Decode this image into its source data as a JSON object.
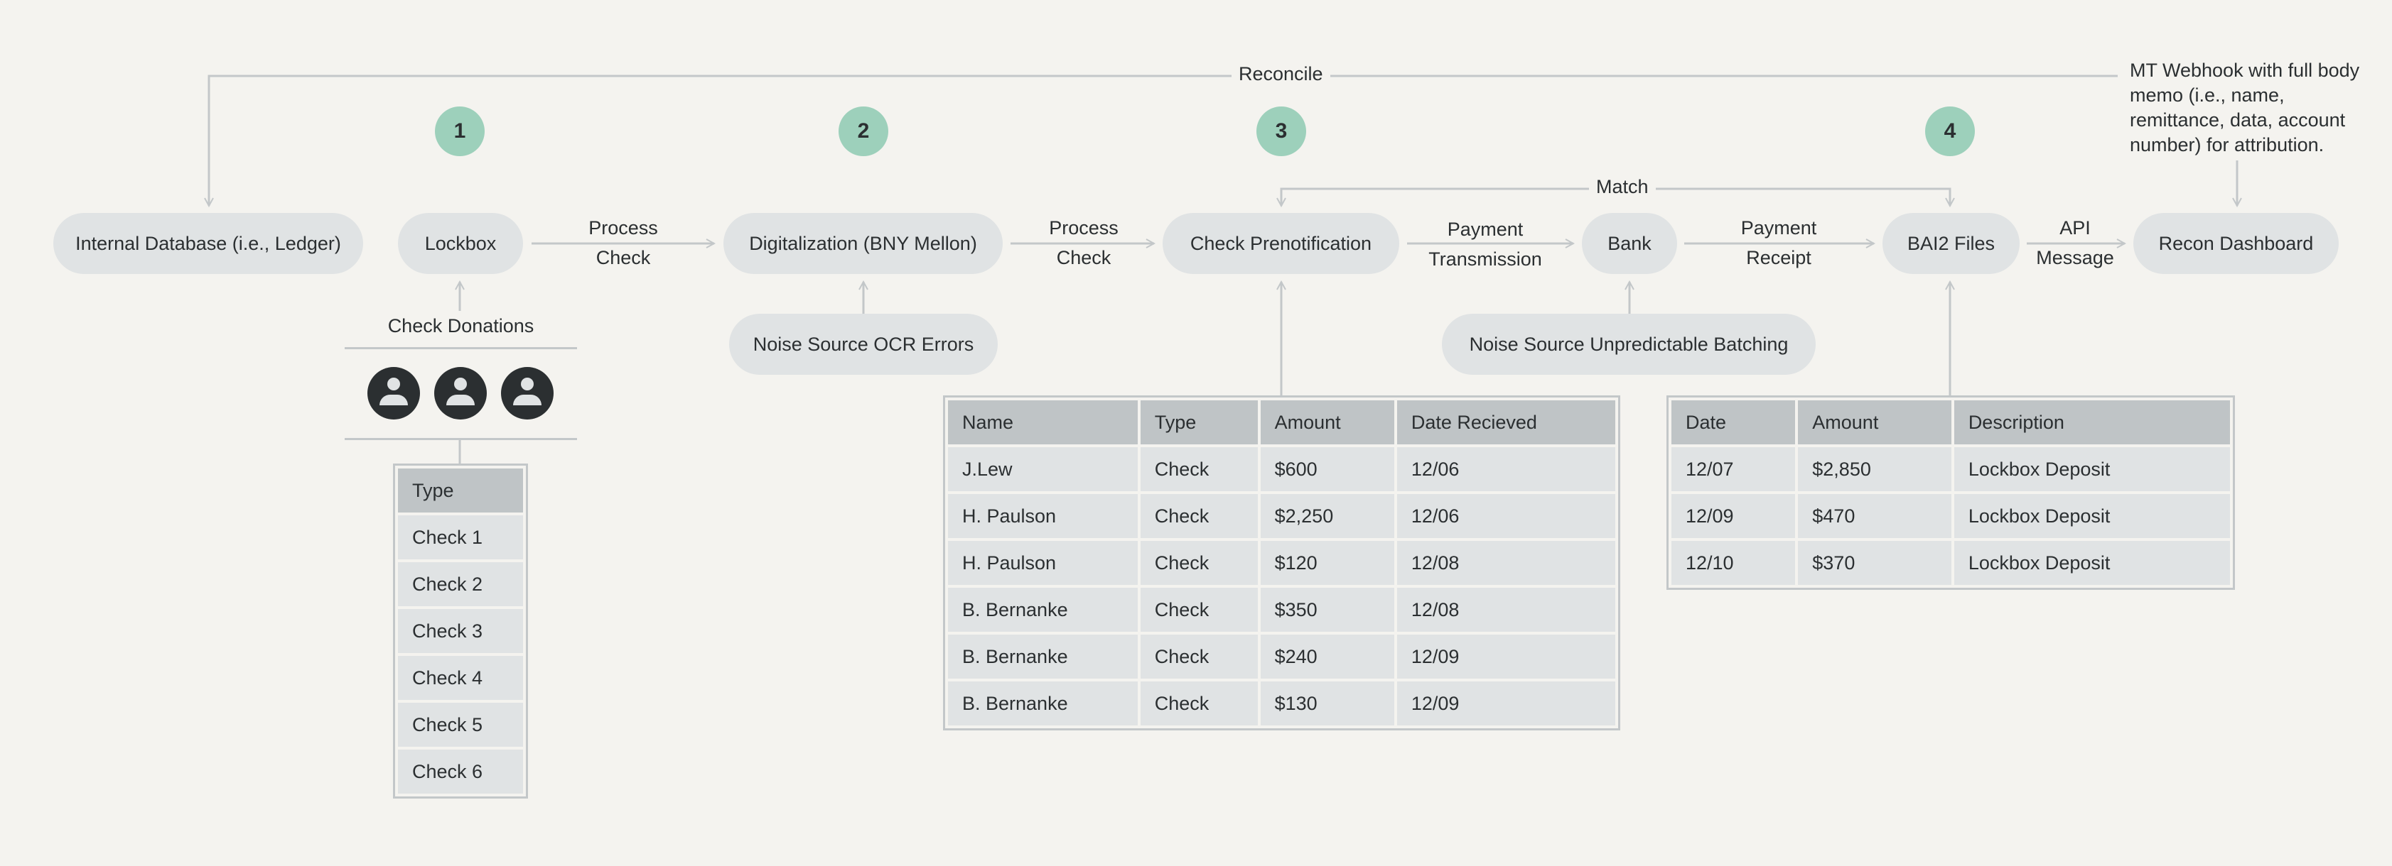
{
  "steps": [
    "1",
    "2",
    "3",
    "4"
  ],
  "nodes": {
    "internal_db": "Internal Database (i.e., Ledger)",
    "lockbox": "Lockbox",
    "digitalization": "Digitalization (BNY Mellon)",
    "check_prenotification": "Check Prenotification",
    "bank": "Bank",
    "bai2_files": "BAI2 Files",
    "recon_dashboard": "Recon Dashboard",
    "noise_ocr": "Noise Source OCR Errors",
    "noise_batching": "Noise Source Unpredictable Batching"
  },
  "edges": {
    "reconcile": "Reconcile",
    "match": "Match",
    "process_check_1": [
      "Process",
      "Check"
    ],
    "process_check_2": [
      "Process",
      "Check"
    ],
    "payment_transmission": [
      "Payment",
      "Transmission"
    ],
    "payment_receipt": [
      "Payment",
      "Receipt"
    ],
    "api_message": [
      "API",
      "Message"
    ]
  },
  "donations": {
    "label": "Check Donations",
    "donor_count": 3
  },
  "memo_note": "MT Webhook with full body memo (i.e., name, remittance, data, account number) for attribution.",
  "checks_table": {
    "header": "Type",
    "rows": [
      "Check 1",
      "Check 2",
      "Check 3",
      "Check 4",
      "Check 5",
      "Check 6"
    ]
  },
  "prenotification_table": {
    "columns": [
      "Name",
      "Type",
      "Amount",
      "Date Recieved"
    ],
    "rows": [
      [
        "J.Lew",
        "Check",
        "$600",
        "12/06"
      ],
      [
        "H. Paulson",
        "Check",
        "$2,250",
        "12/06"
      ],
      [
        "H. Paulson",
        "Check",
        "$120",
        "12/08"
      ],
      [
        "B. Bernanke",
        "Check",
        "$350",
        "12/08"
      ],
      [
        "B. Bernanke",
        "Check",
        "$240",
        "12/09"
      ],
      [
        "B. Bernanke",
        "Check",
        "$130",
        "12/09"
      ]
    ]
  },
  "bai2_table": {
    "columns": [
      "Date",
      "Amount",
      "Description"
    ],
    "rows": [
      [
        "12/07",
        "$2,850",
        "Lockbox Deposit"
      ],
      [
        "12/09",
        "$470",
        "Lockbox Deposit"
      ],
      [
        "12/10",
        "$370",
        "Lockbox Deposit"
      ]
    ]
  },
  "colors": {
    "step_badge": "#9dd0bb",
    "node_fill": "#e0e3e4",
    "table_header": "#bfc4c6",
    "connector": "#c3c7c9",
    "background": "#f4f3ef"
  }
}
